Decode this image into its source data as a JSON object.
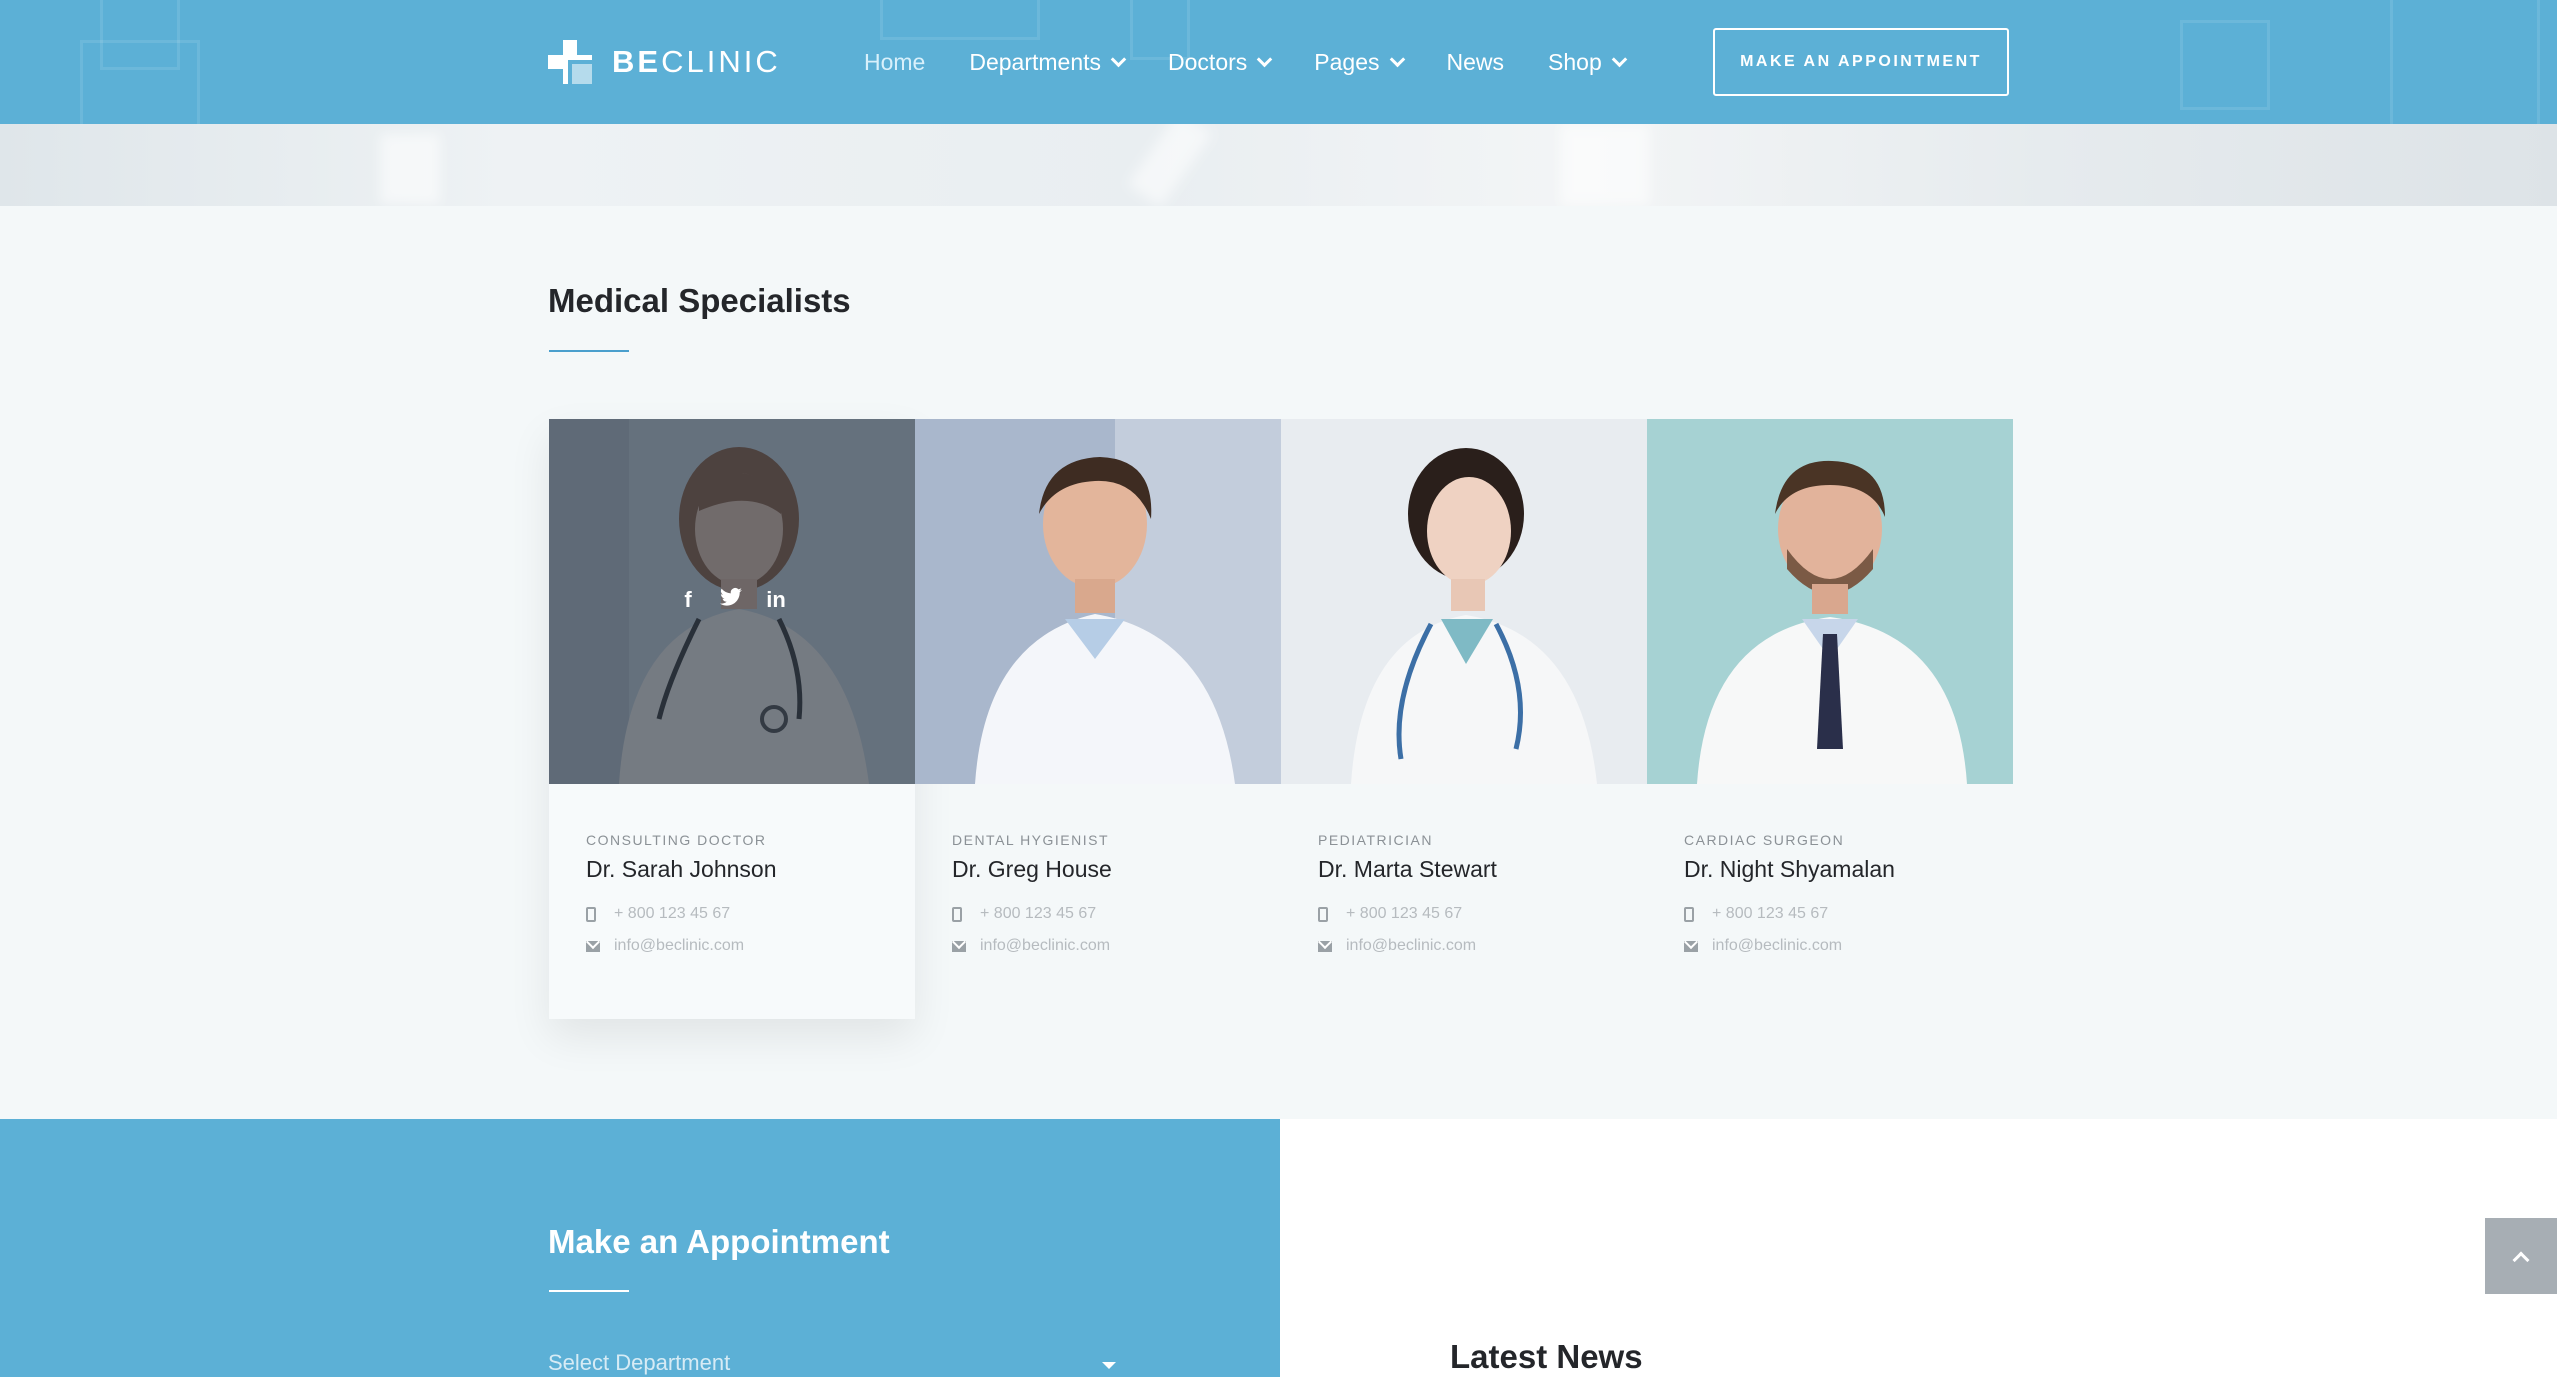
{
  "header": {
    "logo": {
      "bold": "BE",
      "light": "CLINIC"
    },
    "nav": [
      {
        "label": "Home",
        "active": true,
        "dropdown": false
      },
      {
        "label": "Departments",
        "dropdown": true
      },
      {
        "label": "Doctors",
        "dropdown": true
      },
      {
        "label": "Pages",
        "dropdown": true
      },
      {
        "label": "News",
        "dropdown": false
      },
      {
        "label": "Shop",
        "dropdown": true
      }
    ],
    "cta_label": "MAKE AN APPOINTMENT"
  },
  "specialists": {
    "title": "Medical Specialists",
    "socials": [
      "f",
      "t",
      "in"
    ],
    "doctors": [
      {
        "role": "Consulting Doctor",
        "name": "Dr. Sarah Johnson",
        "phone": "+ 800 123 45 67",
        "email": "info@beclinic.com"
      },
      {
        "role": "Dental Hygienist",
        "name": "Dr. Greg House",
        "phone": "+ 800 123 45 67",
        "email": "info@beclinic.com"
      },
      {
        "role": "Pediatrician",
        "name": "Dr. Marta Stewart",
        "phone": "+ 800 123 45 67",
        "email": "info@beclinic.com"
      },
      {
        "role": "Cardiac Surgeon",
        "name": "Dr. Night Shyamalan",
        "phone": "+ 800 123 45 67",
        "email": "info@beclinic.com"
      }
    ]
  },
  "appointment": {
    "title": "Make an Appointment",
    "department_placeholder": "Select Department"
  },
  "news": {
    "title": "Latest News"
  },
  "colors": {
    "brand": "#5cb0d6",
    "accent_rule": "#4a9fcd",
    "text": "#24262a"
  }
}
